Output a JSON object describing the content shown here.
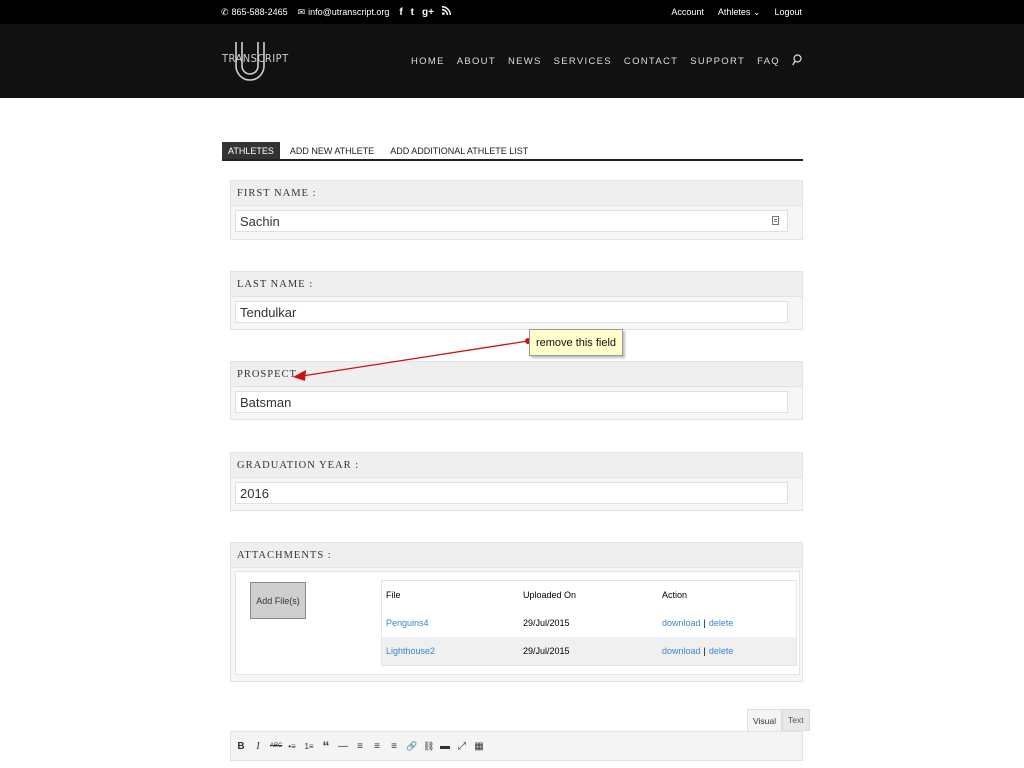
{
  "topbar": {
    "phone": "865-588-2465",
    "email": "info@utranscript.org",
    "social": [
      "f",
      "t",
      "g+",
      "rss"
    ],
    "links": [
      "Account",
      "Athletes",
      "Logout"
    ]
  },
  "logo": {
    "text": "TRANSCRIPT"
  },
  "nav": {
    "items": [
      "HOME",
      "ABOUT",
      "NEWS",
      "SERVICES",
      "CONTACT",
      "SUPPORT",
      "FAQ"
    ]
  },
  "tabs": [
    "ATHLETES",
    "ADD NEW ATHLETE",
    "ADD ADDITIONAL ATHLETE LIST"
  ],
  "fields": [
    {
      "label": "FIRST NAME :",
      "value": "Sachin"
    },
    {
      "label": "LAST NAME :",
      "value": "Tendulkar"
    },
    {
      "label": "PROSPECT :",
      "value": "Batsman"
    },
    {
      "label": "GRADUATION YEAR :",
      "value": "2016"
    }
  ],
  "attachments": {
    "label": "ATTACHMENTS :",
    "add_button": "Add File(s)",
    "headers": [
      "File",
      "Uploaded On",
      "Action"
    ],
    "rows": [
      {
        "file": "Penguins4",
        "date": "29/Jul/2015",
        "download": "download",
        "sep": "|",
        "delete": "delete"
      },
      {
        "file": "Lighthouse2",
        "date": "29/Jul/2015",
        "download": "download",
        "sep": "|",
        "delete": "delete"
      }
    ]
  },
  "editor": {
    "tabs": [
      "Visual",
      "Text"
    ],
    "toolbar": [
      "B",
      "I",
      "ABC",
      "•≡",
      "1≡",
      "“",
      "—",
      "≡",
      "≡",
      "≡",
      "🔗",
      "⛓",
      "▬",
      "⤢",
      "▦"
    ]
  },
  "annotation": {
    "text": "remove this field",
    "color": "#cc1111"
  }
}
